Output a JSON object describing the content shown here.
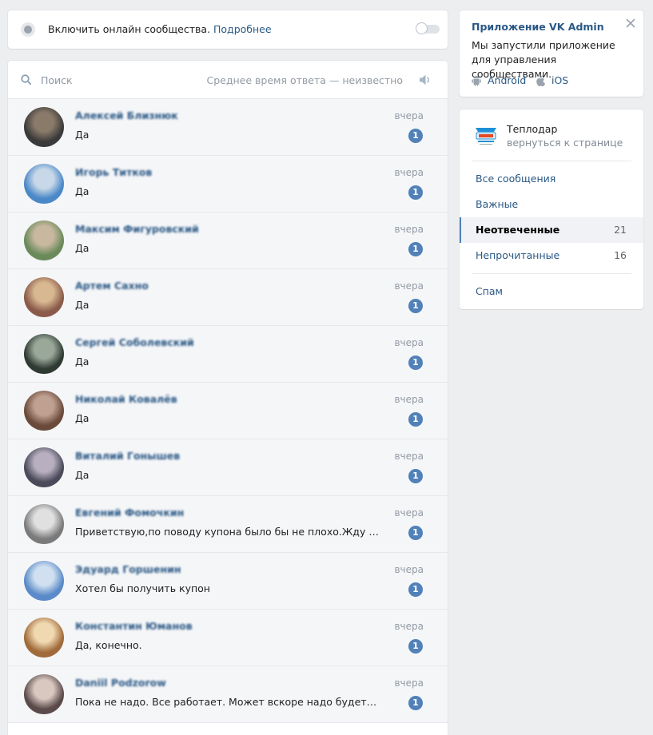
{
  "online": {
    "text": "Включить онлайн сообщества.",
    "link": "Подробнее"
  },
  "dialogs_header": {
    "search_placeholder": "Поиск",
    "response_time": "Среднее время ответа — неизвестно"
  },
  "dialogs": [
    {
      "name": "Алексей Близнюк",
      "time": "вчера",
      "message": "Да",
      "unread": "1"
    },
    {
      "name": "Игорь Титков",
      "time": "вчера",
      "message": "Да",
      "unread": "1"
    },
    {
      "name": "Максим Фигуровский",
      "time": "вчера",
      "message": "Да",
      "unread": "1"
    },
    {
      "name": "Артем Сахно",
      "time": "вчера",
      "message": "Да",
      "unread": "1"
    },
    {
      "name": "Сергей Соболевский",
      "time": "вчера",
      "message": "Да",
      "unread": "1"
    },
    {
      "name": "Николай Ковалёв",
      "time": "вчера",
      "message": "Да",
      "unread": "1"
    },
    {
      "name": "Виталий Гонышев",
      "time": "вчера",
      "message": "Да",
      "unread": "1"
    },
    {
      "name": "Евгений Фомочкин",
      "time": "вчера",
      "message": "Приветствую,по поводу купона было бы не плохо.Жду сооб…",
      "unread": "1"
    },
    {
      "name": "Эдуард Горшенин",
      "time": "вчера",
      "message": "Хотел бы получить купон",
      "unread": "1"
    },
    {
      "name": "Константин Юманов",
      "time": "вчера",
      "message": "Да, конечно.",
      "unread": "1"
    },
    {
      "name": "Daniil Podzorow",
      "time": "вчера",
      "message": "Пока не надо. Все работает. Может вскоре надо будет котел …",
      "unread": "1"
    }
  ],
  "promo": {
    "title": "Приложение VK Admin",
    "text": "Мы запустили приложение для управления сообществами.",
    "android": "Android",
    "ios": "iOS"
  },
  "community": {
    "name": "Теплодар",
    "back": "вернуться к странице"
  },
  "menu": {
    "all": "Все сообщения",
    "important": "Важные",
    "unanswered": "Неотвеченные",
    "unanswered_count": "21",
    "unread": "Непрочитанные",
    "unread_count": "16",
    "spam": "Спам"
  },
  "colors": {
    "link": "#2a5885",
    "badge": "#5181b8",
    "background": "#edeef0"
  }
}
